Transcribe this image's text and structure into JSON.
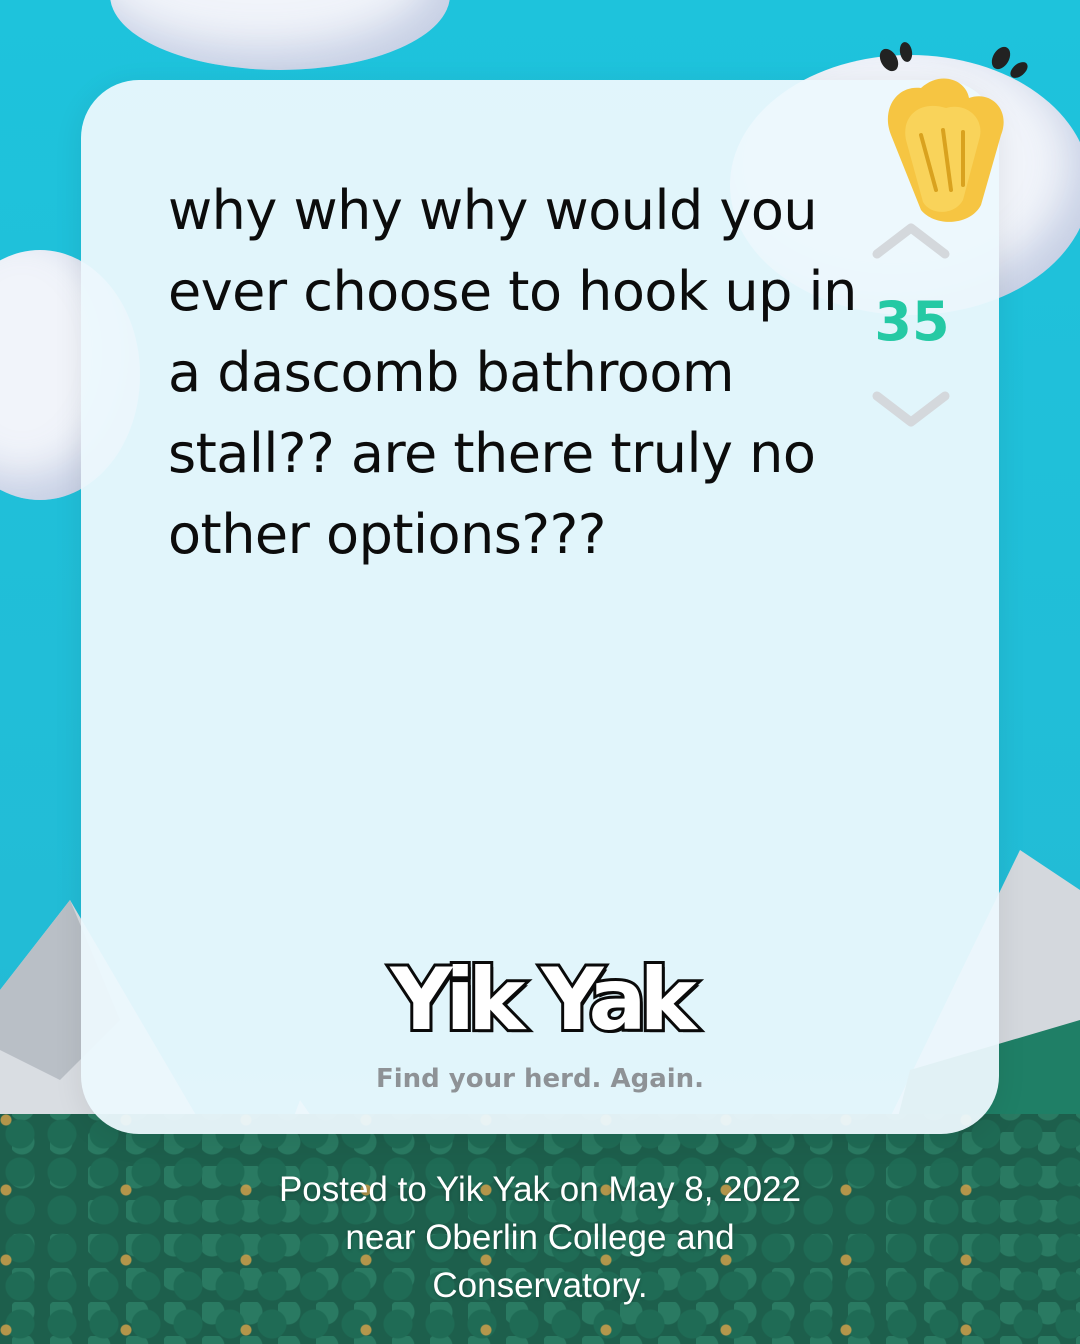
{
  "post": {
    "text": "why why why would you ever choose to hook up in a dascomb bathroom stall?? are there truly no other options???",
    "votes": "35",
    "reaction_icon": "clapping-hands-icon",
    "upvote_icon": "chevron-up-icon",
    "downvote_icon": "chevron-down-icon"
  },
  "brand": {
    "logo": "Yik Yak",
    "tagline": "Find your herd. Again."
  },
  "caption": "Posted to Yik Yak on May 8, 2022 near Oberlin College and Conservatory.",
  "colors": {
    "background": "#1cbfd9",
    "card": "#ecf8fd",
    "vote_count": "#25c9a4",
    "tagline": "#8e9296"
  }
}
